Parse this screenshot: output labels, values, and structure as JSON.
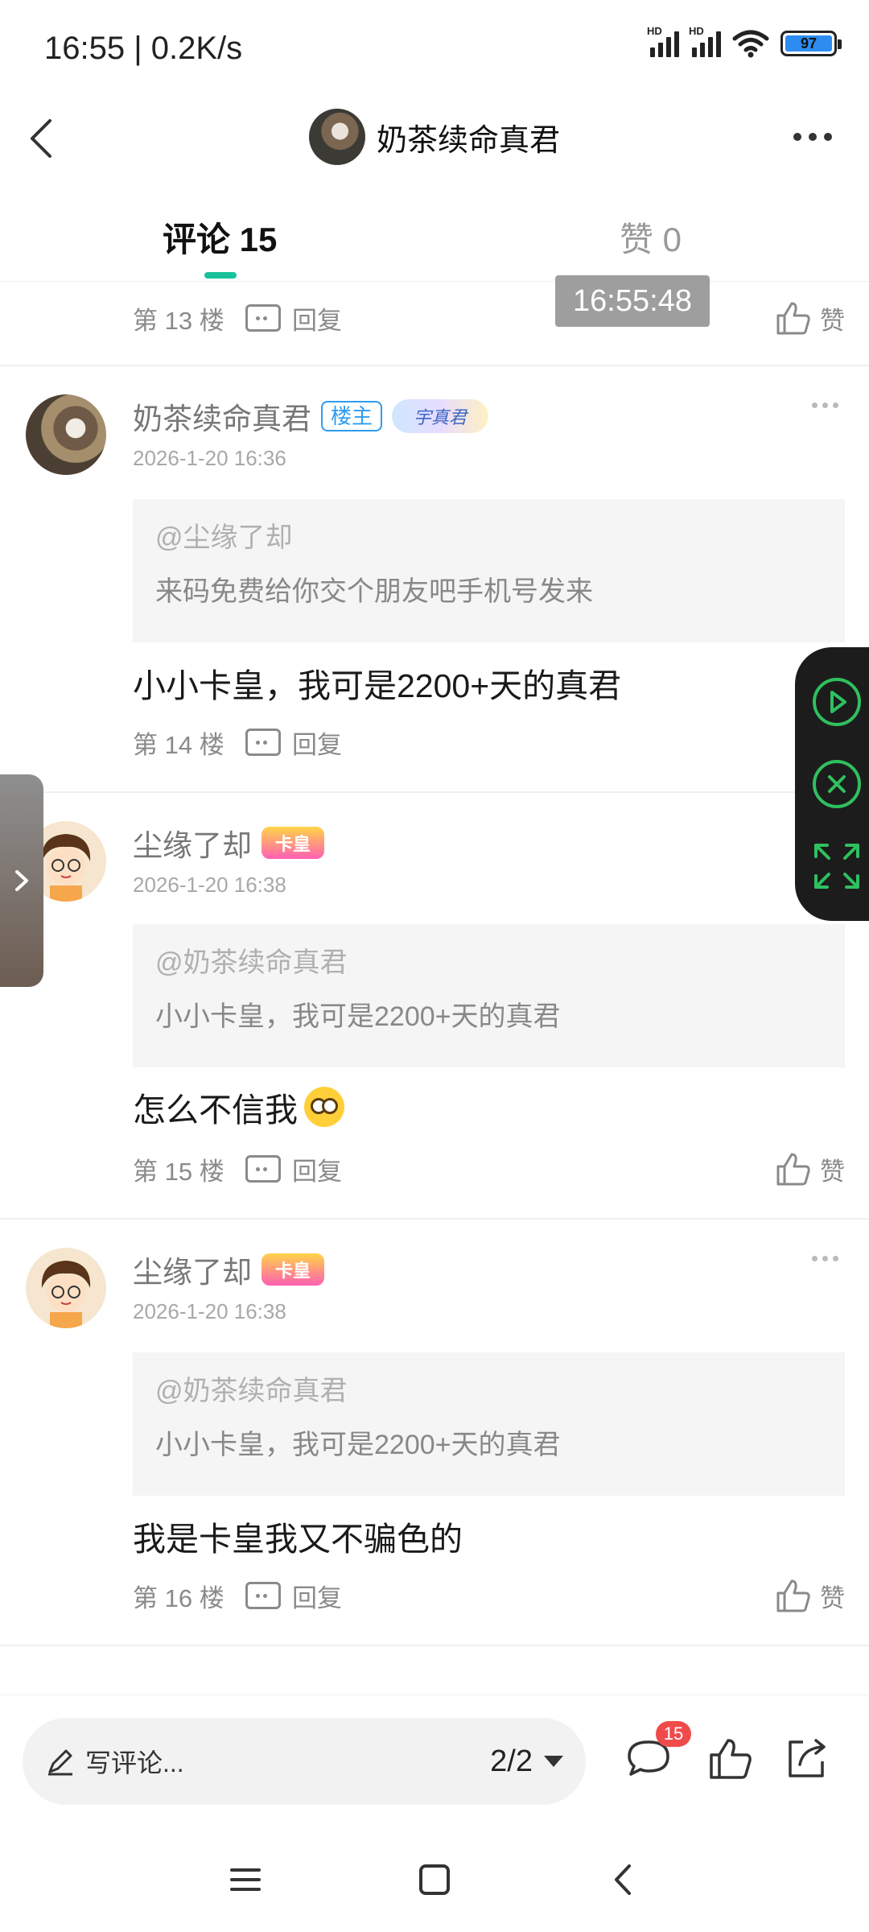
{
  "status": {
    "time": "16:55 | 0.2K/s",
    "battery": "97",
    "signal_label": "HD"
  },
  "header": {
    "title": "奶茶续命真君"
  },
  "tabs": [
    {
      "label": "评论 15"
    },
    {
      "label": "赞 0"
    }
  ],
  "time_overlay": "16:55:48",
  "top_comment": {
    "floor": "第 13 楼",
    "reply": "回复",
    "like": "赞"
  },
  "comments": [
    {
      "username": "奶茶续命真君",
      "owner_badge": "楼主",
      "fan_badge": "宇真君",
      "time": "2026-1-20 16:36",
      "quote_user": "@尘缘了却",
      "quote_text": "来码免费给你交个朋友吧手机号发来",
      "content": "小小卡皇，我可是2200+天的真君",
      "floor": "第 14 楼",
      "reply": "回复"
    },
    {
      "username": "尘缘了却",
      "crown_badge": "卡皇",
      "time": "2026-1-20 16:38",
      "quote_user": "@奶茶续命真君",
      "quote_text": "小小卡皇，我可是2200+天的真君",
      "content": "怎么不信我",
      "floor": "第 15 楼",
      "reply": "回复",
      "like": "赞"
    },
    {
      "username": "尘缘了却",
      "crown_badge": "卡皇",
      "time": "2026-1-20 16:38",
      "quote_user": "@奶茶续命真君",
      "quote_text": "小小卡皇，我可是2200+天的真君",
      "content": "我是卡皇我又不骗色的",
      "floor": "第 16 楼",
      "reply": "回复",
      "like": "赞"
    }
  ],
  "bottom": {
    "placeholder": "写评论...",
    "page": "2/2",
    "comment_badge": "15"
  },
  "colors": {
    "accent": "#19c19c",
    "owner_badge": "#2d9cf0",
    "badge_red": "#f04b4b",
    "float_green": "#2fc05f"
  }
}
